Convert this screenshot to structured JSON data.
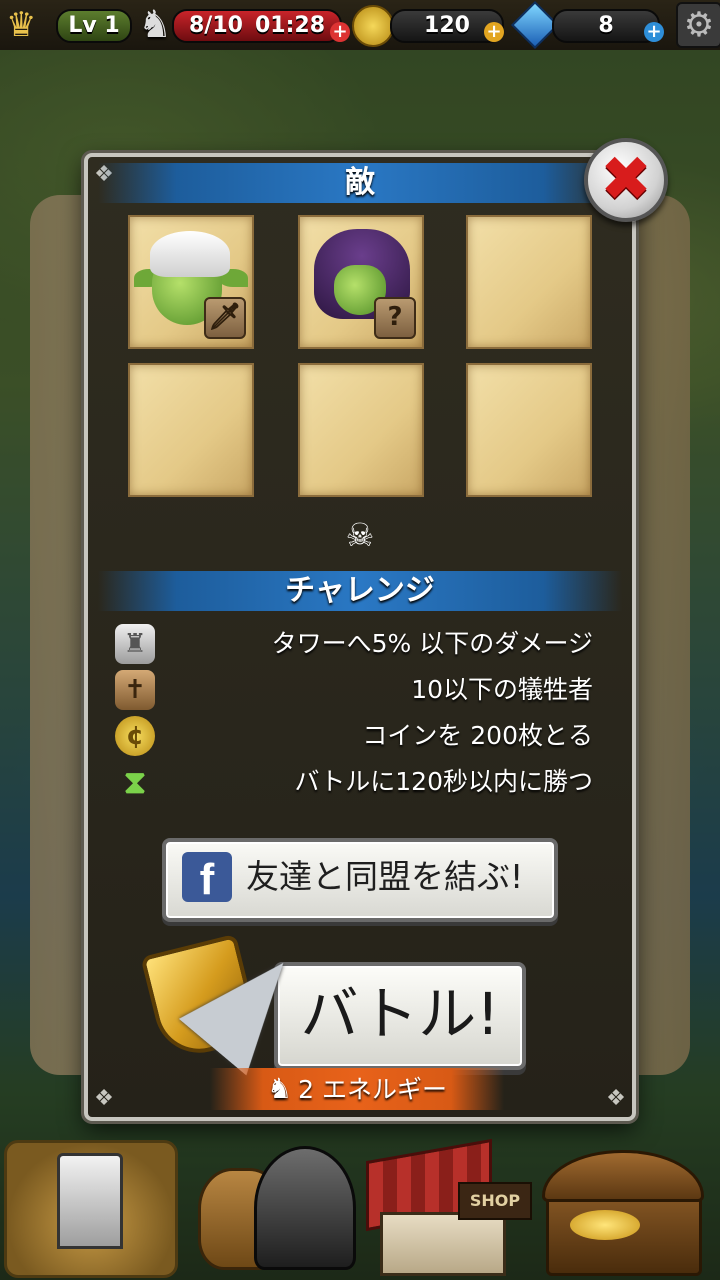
{
  "top_bar": {
    "level_label": "Lv 1",
    "energy_current": "8/10",
    "energy_timer": "01:28",
    "coins": "120",
    "gems": "8"
  },
  "modal": {
    "title": "敵",
    "enemies": [
      {
        "type": "goblin",
        "hood_color": "#ffffff",
        "badge_icon": "sword-icon",
        "badge_glyph": "🗡"
      },
      {
        "type": "goblin",
        "hood_color": "#4b2a6b",
        "badge_icon": "question-icon",
        "badge_glyph": "?"
      }
    ],
    "challenges_title": "チャレンジ",
    "challenges": [
      {
        "icon": "tower-icon",
        "text": "タワーへ5% 以下のダメージ"
      },
      {
        "icon": "grave-icon",
        "text": "10以下の犠牲者"
      },
      {
        "icon": "coin-icon",
        "text": "コインを 200枚とる"
      },
      {
        "icon": "hourglass-icon",
        "text": "バトルに120秒以内に勝つ"
      }
    ],
    "facebook_button": "友達と同盟を結ぶ!",
    "battle_button": "バトル!",
    "energy_cost": "2 エネルギー"
  },
  "bottom_nav": {
    "shop_sign": "SHOP"
  },
  "colors": {
    "header_band": "#2a78c4",
    "energy_bar": "#c8242a",
    "energy_cost_band": "#e8621a",
    "close_x": "#d81c1c",
    "facebook": "#3b5998"
  }
}
